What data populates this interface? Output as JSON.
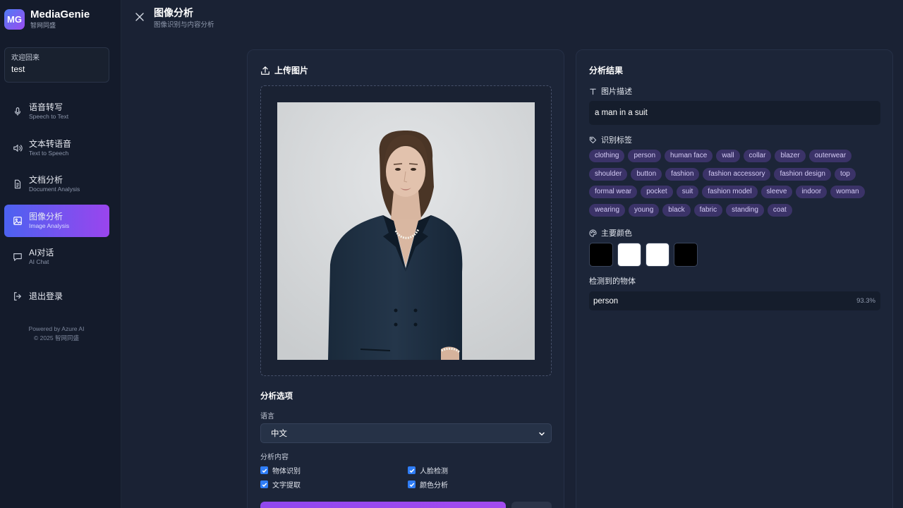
{
  "app": {
    "logo_text": "MG",
    "name": "MediaGenie",
    "subtitle": "智网同盛"
  },
  "welcome": {
    "label": "欢迎回来",
    "user": "test"
  },
  "nav": [
    {
      "title": "语音转写",
      "sub": "Speech to Text",
      "icon": "microphone-icon"
    },
    {
      "title": "文本转语音",
      "sub": "Text to Speech",
      "icon": "speaker-icon"
    },
    {
      "title": "文档分析",
      "sub": "Document Analysis",
      "icon": "document-icon"
    },
    {
      "title": "图像分析",
      "sub": "Image Analysis",
      "icon": "image-icon",
      "active": true
    },
    {
      "title": "AI对话",
      "sub": "AI Chat",
      "icon": "chat-icon"
    }
  ],
  "logout": {
    "label": "退出登录"
  },
  "footer": {
    "line1": "Powered by Azure AI",
    "line2": "© 2025 智网同盛"
  },
  "header": {
    "title": "图像分析",
    "subtitle": "图像识别与内容分析"
  },
  "upload": {
    "title": "上传图片"
  },
  "options": {
    "title": "分析选项",
    "language_label": "语言",
    "language_value": "中文",
    "content_label": "分析内容",
    "checks": [
      {
        "label": "物体识别",
        "checked": true
      },
      {
        "label": "人脸检测",
        "checked": true
      },
      {
        "label": "文字提取",
        "checked": true
      },
      {
        "label": "颜色分析",
        "checked": true
      }
    ]
  },
  "results": {
    "title": "分析结果",
    "description_label": "图片描述",
    "description": "a man in a suit",
    "tags_label": "识别标签",
    "tags": [
      "clothing",
      "person",
      "human face",
      "wall",
      "collar",
      "blazer",
      "outerwear",
      "shoulder",
      "button",
      "fashion",
      "fashion accessory",
      "fashion design",
      "top",
      "formal wear",
      "pocket",
      "suit",
      "fashion model",
      "sleeve",
      "indoor",
      "woman",
      "wearing",
      "young",
      "black",
      "fabric",
      "standing",
      "coat"
    ],
    "colors_label": "主要颜色",
    "colors": [
      "#000000",
      "#ffffff",
      "#ffffff",
      "#000000"
    ],
    "detected_label": "检测到的物体",
    "detected": [
      {
        "name": "person",
        "confidence": "93.3%"
      }
    ]
  }
}
